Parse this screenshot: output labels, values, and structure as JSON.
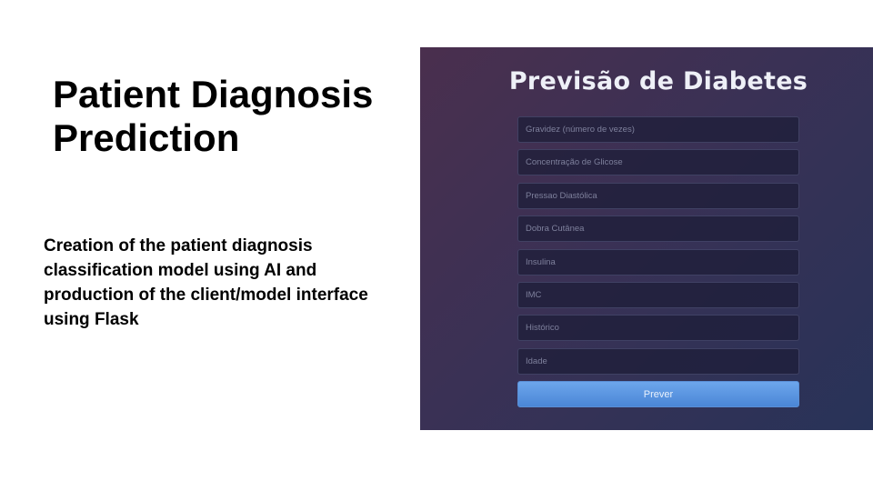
{
  "slide": {
    "title": "Patient Diagnosis Prediction",
    "description": "Creation of the patient diagnosis classification model using AI and production of the client/model interface using Flask"
  },
  "app": {
    "heading": "Previsão de Diabetes",
    "fields": [
      {
        "placeholder": "Gravidez (número de vezes)",
        "value": ""
      },
      {
        "placeholder": "Concentração de Glicose",
        "value": ""
      },
      {
        "placeholder": "Pressao Diastólica",
        "value": ""
      },
      {
        "placeholder": "Dobra Cutânea",
        "value": ""
      },
      {
        "placeholder": "Insulina",
        "value": ""
      },
      {
        "placeholder": "IMC",
        "value": ""
      },
      {
        "placeholder": "Histórico",
        "value": ""
      },
      {
        "placeholder": "Idade",
        "value": ""
      }
    ],
    "submit_label": "Prever",
    "colors": {
      "background_start": "#4a2f4e",
      "background_end": "#283358",
      "button": "#4a86d6"
    }
  }
}
